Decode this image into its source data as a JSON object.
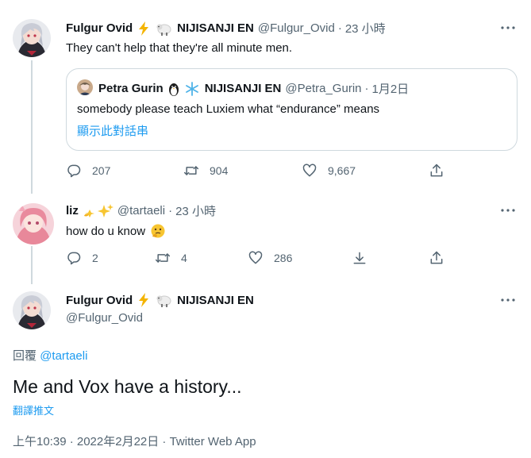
{
  "tweet1": {
    "display_name": "Fulgur Ovid",
    "name_suffix": "NIJISANJI EN",
    "handle": "@Fulgur_Ovid",
    "time": "23 小時",
    "text": "They can't help that they're all minute men.",
    "quote": {
      "display_name": "Petra Gurin",
      "name_suffix": "NIJISANJI EN",
      "handle": "@Petra_Gurin",
      "time": "1月2日",
      "text": "somebody please teach Luxiem what “endurance” means",
      "show_thread": "顯示此對話串"
    },
    "stats": {
      "replies": "207",
      "retweets": "904",
      "likes": "9,667"
    }
  },
  "tweet2": {
    "display_name": "liz",
    "handle": "@tartaeli",
    "time": "23 小時",
    "text": "how do u know",
    "stats": {
      "replies": "2",
      "retweets": "4",
      "likes": "286"
    }
  },
  "main_tweet": {
    "display_name": "Fulgur Ovid",
    "name_suffix": "NIJISANJI EN",
    "handle": "@Fulgur_Ovid",
    "replying_prefix": "回覆",
    "replying_to": "@tartaeli",
    "text": "Me and Vox have a history...",
    "translate": "翻譯推文",
    "meta": "上午10:39 · 2022年2月22日 · Twitter Web App"
  },
  "colors": {
    "text": "#0f1419",
    "secondary": "#536471",
    "link": "#1d9bf0",
    "border": "#cfd9de"
  },
  "icons": [
    "more-icon",
    "lightning-icon",
    "sheep-icon",
    "penguin-icon",
    "snowflake-icon",
    "sparkles-icon",
    "thinking-face-icon",
    "reply-icon",
    "retweet-icon",
    "like-icon",
    "share-icon",
    "download-icon"
  ]
}
